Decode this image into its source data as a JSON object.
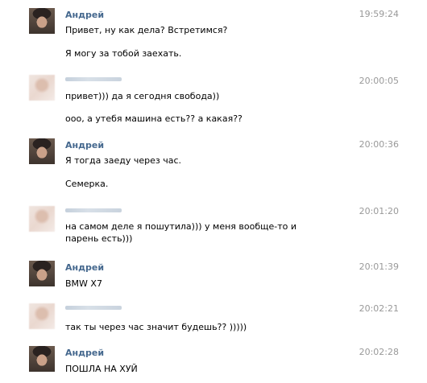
{
  "messages": [
    {
      "author": "Андрей",
      "time": "19:59:24",
      "lines": [
        "Привет, ну как дела? Встретимся?",
        "Я могу за тобой заехать."
      ]
    },
    {
      "author": "",
      "time": "20:00:05",
      "lines": [
        "привет))) да я сегодня свобода))",
        "ооо, а утебя машина есть?? а какая??"
      ]
    },
    {
      "author": "Андрей",
      "time": "20:00:36",
      "lines": [
        "Я тогда заеду через час.",
        "Семерка."
      ]
    },
    {
      "author": "",
      "time": "20:01:20",
      "lines": [
        "на самом деле я пошутила))) у меня вообще-то и парень есть)))"
      ]
    },
    {
      "author": "Андрей",
      "time": "20:01:39",
      "lines": [
        "BMW X7"
      ]
    },
    {
      "author": "",
      "time": "20:02:21",
      "lines": [
        "так ты через час значит будешь?? )))))"
      ]
    },
    {
      "author": "Андрей",
      "time": "20:02:28",
      "lines": [
        "ПОШЛА НА ХУЙ"
      ]
    }
  ]
}
